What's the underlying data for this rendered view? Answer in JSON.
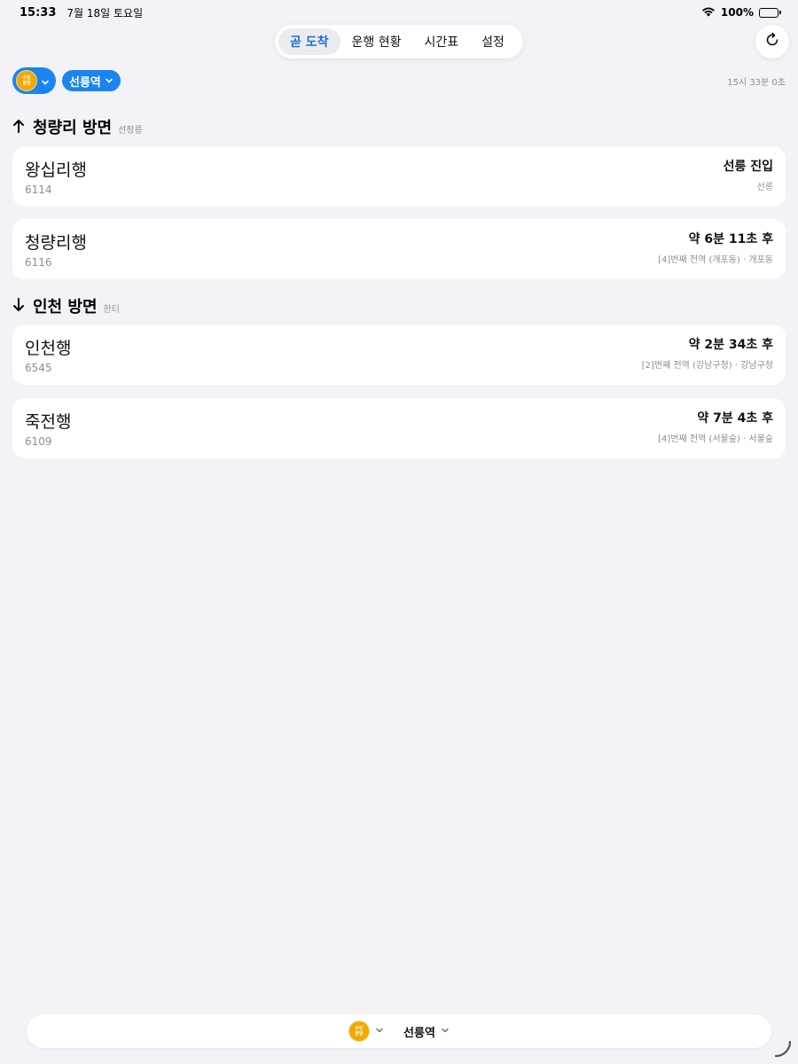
{
  "status": {
    "time": "15:33",
    "date": "7월 18일 토요일",
    "battery": "100%"
  },
  "tabs": [
    {
      "label": "곧 도착",
      "active": true
    },
    {
      "label": "운행 현황",
      "active": false
    },
    {
      "label": "시간표",
      "active": false
    },
    {
      "label": "설정",
      "active": false
    }
  ],
  "line": {
    "badge_line1": "수인",
    "badge_line2": "분당",
    "color": "#f2a900"
  },
  "station": {
    "name": "선릉역"
  },
  "updated_time": "15시 33분 0초",
  "sections": [
    {
      "direction_icon": "up-arrow-icon",
      "title": "청량리 방면",
      "next_station": "선정릉",
      "trains": [
        {
          "destination": "왕십리행",
          "number": "6114",
          "eta": "선릉 진입",
          "detail": "선릉"
        },
        {
          "destination": "청량리행",
          "number": "6116",
          "eta": "약 6분 11초 후",
          "detail": "[4]번째 전역 (개포동) · 개포동"
        }
      ]
    },
    {
      "direction_icon": "down-arrow-icon",
      "title": "인천 방면",
      "next_station": "한티",
      "trains": [
        {
          "destination": "인천행",
          "number": "6545",
          "eta": "약 2분 34초 후",
          "detail": "[2]번째 전역 (강남구청) · 강남구청"
        },
        {
          "destination": "죽전행",
          "number": "6109",
          "eta": "약 7분 4초 후",
          "detail": "[4]번째 전역 (서울숲) · 서울숲"
        }
      ]
    }
  ],
  "colors": {
    "accent": "#1a84f0",
    "active_tab_text": "#1b6fd6",
    "background": "#f2f2f7"
  }
}
